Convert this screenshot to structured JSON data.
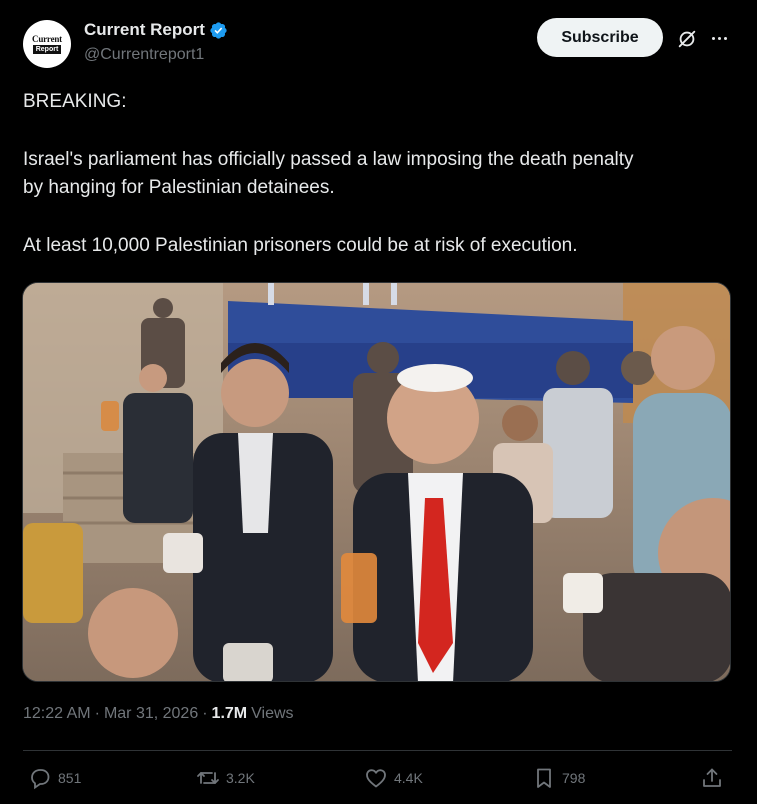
{
  "account": {
    "display_name": "Current Report",
    "handle": "@Currentreport1",
    "avatar_line1": "Current",
    "avatar_line2": "Report",
    "verified": true
  },
  "header": {
    "subscribe_label": "Subscribe"
  },
  "tweet": {
    "paragraphs": [
      "BREAKING:",
      "Israel's parliament has officially passed a law imposing the death penalty\nby hanging for Palestinian detainees.",
      "At least 10,000 Palestinian prisoners could be at risk of execution."
    ]
  },
  "meta": {
    "time": "12:22 AM",
    "separator": "·",
    "date": "Mar 31, 2026",
    "views_count": "1.7M",
    "views_label": "Views"
  },
  "actions": {
    "replies": "851",
    "reposts": "3.2K",
    "likes": "4.4K",
    "bookmarks": "798"
  },
  "colors": {
    "background": "#000000",
    "text": "#e7e9ea",
    "muted": "#71767b",
    "verified": "#1d9bf0",
    "subscribe_bg": "#eff3f4"
  },
  "icons": [
    "verified-badge-icon",
    "grok-icon",
    "more-icon",
    "reply-icon",
    "repost-icon",
    "like-icon",
    "bookmark-icon",
    "share-icon"
  ]
}
